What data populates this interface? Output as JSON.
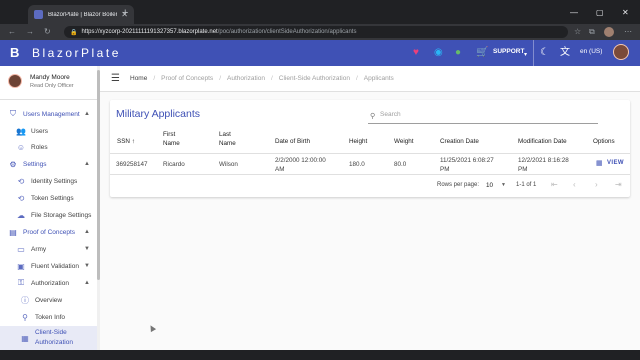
{
  "browser": {
    "tab_title": "BlazorPlate | Blazor Boilerplate",
    "new_tab": "+",
    "url_host": "https://xyzcorp-20211111191327357.blazorplate.net",
    "url_path": "/poc/authorization/clientSideAuthorization/applicants",
    "window_min": "—",
    "window_max": "▢",
    "window_close": "✕"
  },
  "appbar": {
    "brand": "BlazorPlate",
    "support": "SUPPORT",
    "language": "en (US)"
  },
  "sidebar": {
    "user_name": "Mandy Moore",
    "user_role": "Read Only Officer",
    "items": [
      {
        "label": "Users Management",
        "icon": "shield-icon"
      },
      {
        "label": "Users",
        "icon": "users-icon"
      },
      {
        "label": "Roles",
        "icon": "roles-icon"
      },
      {
        "label": "Settings",
        "icon": "gear-icon"
      },
      {
        "label": "Identity Settings",
        "icon": "identity-icon"
      },
      {
        "label": "Token Settings",
        "icon": "token-icon"
      },
      {
        "label": "File Storage Settings",
        "icon": "cloud-icon"
      },
      {
        "label": "Proof of Concepts",
        "icon": "poc-icon"
      },
      {
        "label": "Army",
        "icon": "army-icon"
      },
      {
        "label": "Fluent Validation",
        "icon": "validation-icon"
      },
      {
        "label": "Authorization",
        "icon": "authorization-icon"
      },
      {
        "label": "Overview",
        "icon": "overview-icon"
      },
      {
        "label": "Token Info",
        "icon": "token-info-icon"
      },
      {
        "label": "Client-Side Authorization",
        "icon": "client-side-icon"
      }
    ]
  },
  "breadcrumb": [
    "Home",
    "Proof of Concepts",
    "Authorization",
    "Client-Side Authorization",
    "Applicants"
  ],
  "card": {
    "title": "Military Applicants",
    "search_placeholder": "Search"
  },
  "table": {
    "headers": {
      "ssn": "SSN",
      "first_name_1": "First",
      "first_name_2": "Name",
      "last_name_1": "Last",
      "last_name_2": "Name",
      "dob": "Date of Birth",
      "height": "Height",
      "weight": "Weight",
      "created": "Creation Date",
      "modified": "Modification Date",
      "options": "Options"
    },
    "rows": [
      {
        "ssn": "369258147",
        "first": "Ricardo",
        "last": "Wilson",
        "dob_1": "2/2/2000 12:00:00",
        "dob_2": "AM",
        "height": "180.0",
        "weight": "80.0",
        "created_1": "11/25/2021 6:08:27",
        "created_2": "PM",
        "modified_1": "12/2/2021 8:16:28",
        "modified_2": "PM",
        "action": "VIEW"
      }
    ]
  },
  "pager": {
    "rows_per_page_label": "Rows per page:",
    "rows_per_page": "10",
    "range": "1-1 of 1"
  }
}
